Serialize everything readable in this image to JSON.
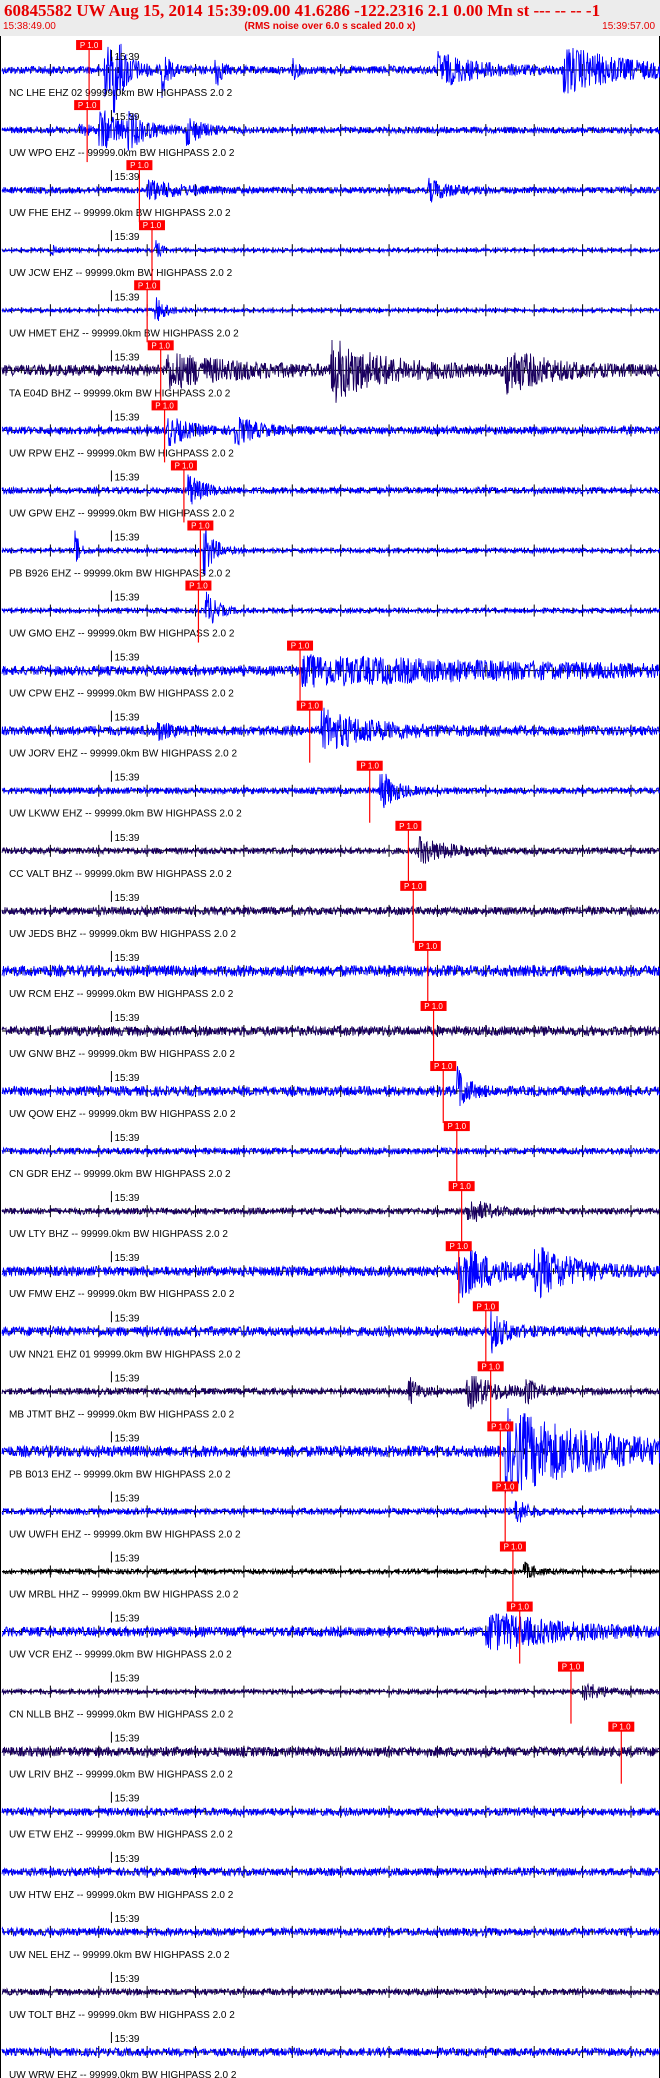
{
  "header": {
    "title": "60845582 UW Aug 15, 2014 15:39:09.00   41.6286 -122.2316  2.1 0.00 Mn st --- -- --  -1",
    "subtitle": "(RMS noise over 6.0 s scaled 20.0 x)",
    "time_start": "15:38:49.00",
    "time_end": "15:39:57.00"
  },
  "chart_data": {
    "type": "line",
    "title": "60845582 UW Aug 15, 2014 15:39:09.00   41.6286 -122.2316  2.1 0.00 Mn st --- -- --  -1",
    "x_range_seconds": [
      0,
      68
    ],
    "x_start": "15:38:49.00",
    "x_end": "15:39:57.00",
    "minute_label": "15:39",
    "minute_label_offset_s": 11,
    "pick_label": "P 1.0",
    "filter_note": "99999.0km BW  HIGHPASS  2.0  2",
    "colors": {
      "trace_primary": "#0000ff",
      "trace_alt": "#1a0060",
      "trace_black": "#000000",
      "pick": "#ff0000",
      "pick_text": "#ffffff"
    },
    "traces": [
      {
        "label": "NC LHE EHZ 02 99999.0km BW  HIGHPASS  2.0  2",
        "pick_s": 9.0,
        "color": "#0000ff",
        "noise": 0.25,
        "events": [
          [
            10.5,
            1.5,
            1.8
          ],
          [
            11.5,
            1.2,
            1.8
          ],
          [
            16.5,
            0.6,
            1.6
          ],
          [
            22,
            0.5,
            1.5
          ],
          [
            30,
            0.5,
            0.6
          ],
          [
            45,
            4,
            1.0
          ],
          [
            58,
            6,
            1.4
          ]
        ]
      },
      {
        "label": "UW WPO EHZ -- 99999.0km BW  HIGHPASS  2.0  2",
        "pick_s": 8.8,
        "color": "#0000ff",
        "noise": 0.2,
        "events": [
          [
            8,
            1,
            0.4
          ],
          [
            10,
            2.5,
            1.3
          ],
          [
            13,
            1.5,
            0.9
          ],
          [
            19,
            1.5,
            0.9
          ]
        ]
      },
      {
        "label": "UW FHE EHZ -- 99999.0km BW  HIGHPASS  2.0  2",
        "pick_s": 14.2,
        "color": "#0000ff",
        "noise": 0.2,
        "events": [
          [
            15,
            3,
            0.6
          ],
          [
            44,
            2,
            0.7
          ]
        ]
      },
      {
        "label": "UW JCW EHZ -- 99999.0km BW  HIGHPASS  2.0  2",
        "pick_s": 15.5,
        "color": "#0000ff",
        "noise": 0.12,
        "events": [
          [
            5,
            0.4,
            0.5
          ],
          [
            15.8,
            0.6,
            0.7
          ]
        ]
      },
      {
        "label": "UW HMET EHZ -- 99999.0km BW  HIGHPASS  2.0  2",
        "pick_s": 15.0,
        "color": "#0000ff",
        "noise": 0.12,
        "events": [
          [
            15.8,
            1.0,
            0.9
          ]
        ]
      },
      {
        "label": "TA E04D BHZ -- 99999.0km BW  HIGHPASS  2.0  2",
        "pick_s": 16.4,
        "color": "#1a0060",
        "noise": 0.35,
        "events": [
          [
            17,
            6,
            1.0
          ],
          [
            34,
            5,
            1.8
          ],
          [
            52,
            4,
            1.3
          ]
        ]
      },
      {
        "label": "UW RPW EHZ -- 99999.0km BW  HIGHPASS  2.0  2",
        "pick_s": 16.8,
        "color": "#0000ff",
        "noise": 0.25,
        "events": [
          [
            17,
            2,
            0.9
          ],
          [
            24,
            2,
            0.9
          ]
        ]
      },
      {
        "label": "UW GPW EHZ -- 99999.0km BW  HIGHPASS  2.0  2",
        "pick_s": 18.8,
        "color": "#0000ff",
        "noise": 0.2,
        "events": [
          [
            19.2,
            1.5,
            1.0
          ]
        ]
      },
      {
        "label": "PB B926 EHZ -- 99999.0km BW  HIGHPASS  2.0  2",
        "pick_s": 20.5,
        "color": "#0000ff",
        "noise": 0.15,
        "events": [
          [
            7.5,
            0.4,
            1.5
          ],
          [
            20.8,
            1,
            1.8
          ]
        ]
      },
      {
        "label": "UW GMO EHZ -- 99999.0km BW  HIGHPASS  2.0  2",
        "pick_s": 20.3,
        "color": "#0000ff",
        "noise": 0.15,
        "events": [
          [
            21,
            1,
            1.4
          ]
        ]
      },
      {
        "label": "UW CPW EHZ -- 99999.0km BW  HIGHPASS  2.0  2",
        "pick_s": 30.8,
        "color": "#0000ff",
        "noise": 0.3,
        "events": [
          [
            31,
            25,
            0.8
          ]
        ]
      },
      {
        "label": "UW JORV EHZ -- 99999.0km BW  HIGHPASS  2.0  2",
        "pick_s": 31.8,
        "color": "#0000ff",
        "noise": 0.3,
        "events": [
          [
            33,
            5,
            1.2
          ],
          [
            16,
            1,
            0.6
          ]
        ]
      },
      {
        "label": "UW LKWW EHZ -- 99999.0km BW  HIGHPASS  2.0  2",
        "pick_s": 38.0,
        "color": "#0000ff",
        "noise": 0.2,
        "events": [
          [
            39,
            1.5,
            1.4
          ]
        ]
      },
      {
        "label": "CC VALT BHZ -- 99999.0km BW  HIGHPASS  2.0  2",
        "pick_s": 42.0,
        "color": "#1a0060",
        "noise": 0.2,
        "events": [
          [
            43,
            3,
            0.8
          ]
        ]
      },
      {
        "label": "UW JEDS BHZ -- 99999.0km BW  HIGHPASS  2.0  2",
        "pick_s": 42.5,
        "color": "#1a0060",
        "noise": 0.25,
        "events": []
      },
      {
        "label": "UW RCM EHZ -- 99999.0km BW  HIGHPASS  2.0  2",
        "pick_s": 44.0,
        "color": "#0000ff",
        "noise": 0.35,
        "events": []
      },
      {
        "label": "UW GNW BHZ -- 99999.0km BW  HIGHPASS  2.0  2",
        "pick_s": 44.6,
        "color": "#1a0060",
        "noise": 0.3,
        "events": []
      },
      {
        "label": "UW QOW EHZ -- 99999.0km BW  HIGHPASS  2.0  2",
        "pick_s": 45.6,
        "color": "#0000ff",
        "noise": 0.3,
        "events": [
          [
            47,
            1,
            1.5
          ]
        ]
      },
      {
        "label": "CN GDR EHZ -- 99999.0km BW  HIGHPASS  2.0  2",
        "pick_s": 47.0,
        "color": "#0000ff",
        "noise": 0.2,
        "events": []
      },
      {
        "label": "UW LTY BHZ -- 99999.0km BW  HIGHPASS  2.0  2",
        "pick_s": 47.5,
        "color": "#1a0060",
        "noise": 0.2,
        "events": [
          [
            48,
            2,
            0.9
          ]
        ]
      },
      {
        "label": "UW FMW EHZ -- 99999.0km BW  HIGHPASS  2.0  2",
        "pick_s": 47.2,
        "color": "#0000ff",
        "noise": 0.3,
        "events": [
          [
            47,
            4,
            1.6
          ],
          [
            55,
            4,
            1.4
          ]
        ]
      },
      {
        "label": "UW NN21 EHZ 01 99999.0km BW  HIGHPASS  2.0  2",
        "pick_s": 50.0,
        "color": "#0000ff",
        "noise": 0.3,
        "events": [
          [
            50.5,
            1.5,
            1.2
          ]
        ]
      },
      {
        "label": "MB JTMT BHZ -- 99999.0km BW  HIGHPASS  2.0  2",
        "pick_s": 50.5,
        "color": "#1a0060",
        "noise": 0.2,
        "events": [
          [
            42,
            1,
            0.9
          ],
          [
            48,
            3,
            1.1
          ],
          [
            54,
            1,
            0.8
          ]
        ]
      },
      {
        "label": "PB B013 EHZ -- 99999.0km BW  HIGHPASS  2.0  2",
        "pick_s": 51.5,
        "color": "#0000ff",
        "noise": 0.35,
        "events": [
          [
            52,
            10,
            2.5
          ]
        ]
      },
      {
        "label": "UW UWFH EHZ -- 99999.0km BW  HIGHPASS  2.0  2",
        "pick_s": 52.0,
        "color": "#0000ff",
        "noise": 0.2,
        "events": [
          [
            53,
            1,
            1.0
          ]
        ]
      },
      {
        "label": "UW MRBL HHZ -- 99999.0km BW  HIGHPASS  2.0  2",
        "pick_s": 52.8,
        "color": "#000000",
        "noise": 0.15,
        "events": [
          [
            53.8,
            1,
            0.6
          ]
        ]
      },
      {
        "label": "UW VCR EHZ -- 99999.0km BW  HIGHPASS  2.0  2",
        "pick_s": 53.5,
        "color": "#0000ff",
        "noise": 0.3,
        "events": [
          [
            50,
            8,
            1.1
          ]
        ]
      },
      {
        "label": "CN NLLB BHZ -- 99999.0km BW  HIGHPASS  2.0  2",
        "pick_s": 58.8,
        "color": "#1a0060",
        "noise": 0.15,
        "events": [
          [
            60,
            2,
            0.6
          ]
        ]
      },
      {
        "label": "UW LRIV BHZ -- 99999.0km BW  HIGHPASS  2.0  2",
        "pick_s": 64.0,
        "color": "#1a0060",
        "noise": 0.3,
        "events": []
      },
      {
        "label": "UW ETW EHZ -- 99999.0km BW  HIGHPASS  2.0  2",
        "pick_s": null,
        "color": "#0000ff",
        "noise": 0.25,
        "events": []
      },
      {
        "label": "UW HTW EHZ -- 99999.0km BW  HIGHPASS  2.0  2",
        "pick_s": null,
        "color": "#0000ff",
        "noise": 0.25,
        "events": []
      },
      {
        "label": "UW NEL EHZ -- 99999.0km BW  HIGHPASS  2.0  2",
        "pick_s": null,
        "color": "#0000ff",
        "noise": 0.25,
        "events": []
      },
      {
        "label": "UW TOLT BHZ -- 99999.0km BW  HIGHPASS  2.0  2",
        "pick_s": null,
        "color": "#1a0060",
        "noise": 0.2,
        "events": []
      },
      {
        "label": "UW WRW EHZ -- 99999.0km BW  HIGHPASS  2.0  2",
        "pick_s": null,
        "color": "#0000ff",
        "noise": 0.25,
        "events": []
      }
    ]
  }
}
